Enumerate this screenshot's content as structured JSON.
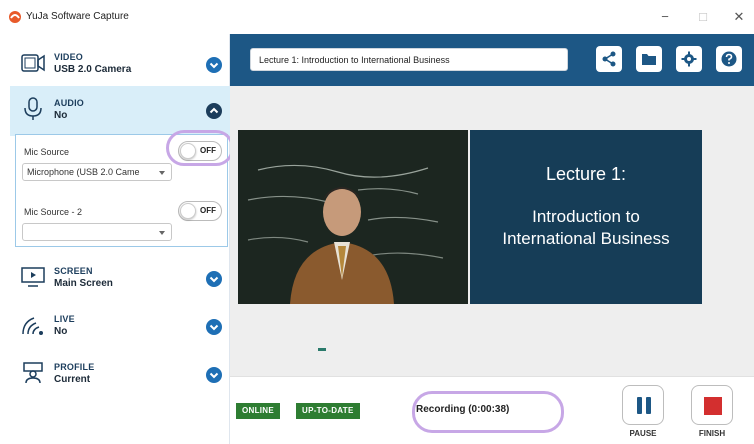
{
  "window": {
    "title": "YuJa Software Capture",
    "minimize": "−",
    "maximize": "□",
    "close": "✕"
  },
  "sidebar": {
    "sections": [
      {
        "name": "VIDEO",
        "value": "USB 2.0 Camera",
        "icon": "camera-icon"
      },
      {
        "name": "AUDIO",
        "value": "No",
        "icon": "microphone-icon",
        "expanded": true
      },
      {
        "name": "SCREEN",
        "value": "Main Screen",
        "icon": "screen-icon"
      },
      {
        "name": "LIVE",
        "value": "No",
        "icon": "live-icon"
      },
      {
        "name": "PROFILE",
        "value": "Current",
        "icon": "profile-icon"
      }
    ],
    "audio": {
      "mic_source_label": "Mic Source",
      "mic_source_toggle": "OFF",
      "mic_source_value": "Microphone (USB 2.0 Came",
      "mic_source2_label": "Mic Source - 2",
      "mic_source2_toggle": "OFF",
      "mic_source2_value": ""
    }
  },
  "header": {
    "lecture_title": "Lecture 1: Introduction to International Business",
    "buttons": [
      "share-icon",
      "folder-icon",
      "gear-icon",
      "help-icon"
    ]
  },
  "preview": {
    "slide_title": "Lecture 1:",
    "slide_body": "Introduction to International Business"
  },
  "status": {
    "online": "ONLINE",
    "update": "UP-TO-DATE",
    "recording": "Recording (0:00:38)",
    "pause_label": "PAUSE",
    "finish_label": "FINISH"
  },
  "colors": {
    "accent": "#1d5785",
    "chevron": "#1e6fb5",
    "badge": "#2e7d32",
    "stop": "#d32f2f",
    "highlight": "#c7a7e6"
  }
}
